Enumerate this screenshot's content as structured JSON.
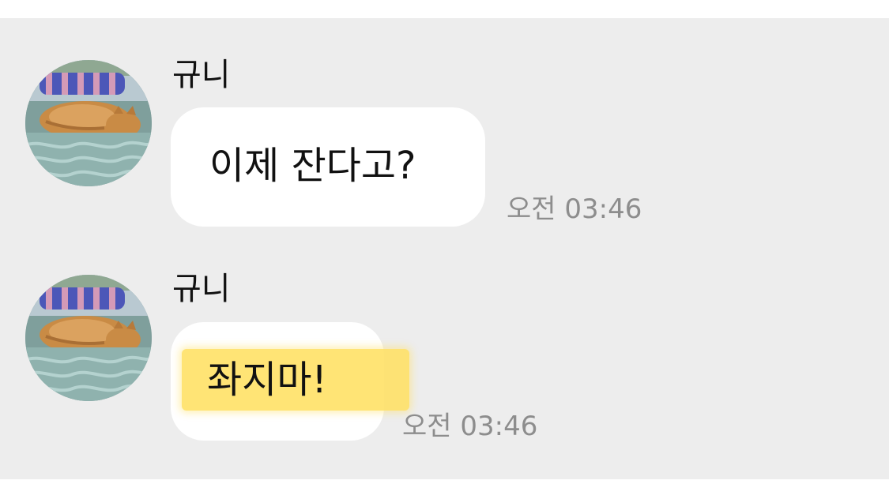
{
  "chat": {
    "messages": [
      {
        "sender": "규니",
        "text": "이제 잔다고?",
        "time": "오전 03:46",
        "highlighted": false
      },
      {
        "sender": "규니",
        "text": "좌지마!",
        "time": "오전 03:46",
        "highlighted": true,
        "highlight_color": "#ffe26a"
      }
    ]
  },
  "colors": {
    "background": "#ededed",
    "bubble": "#ffffff",
    "timestamp": "#8d8d8d",
    "highlight": "#ffe26a"
  },
  "icons": {
    "avatar": "sleeping-cat-profile-photo"
  }
}
